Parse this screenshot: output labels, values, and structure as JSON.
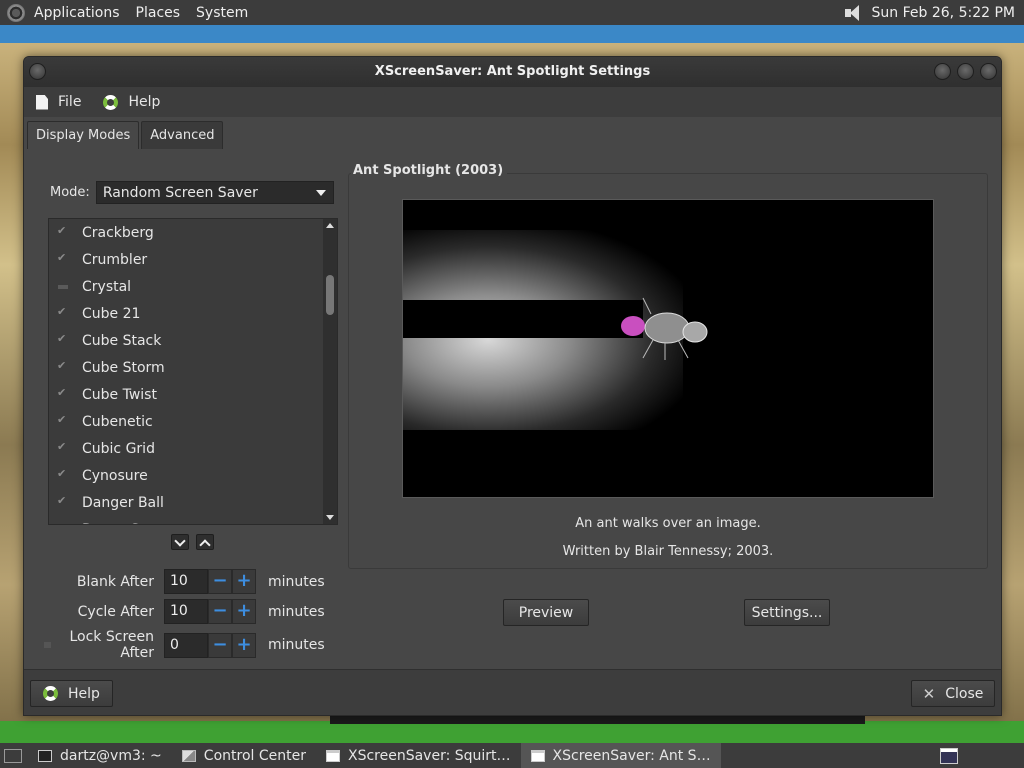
{
  "top_panel": {
    "menus": [
      "Applications",
      "Places",
      "System"
    ],
    "clock": "Sun Feb 26,  5:22 PM"
  },
  "window": {
    "title": "XScreenSaver: Ant Spotlight Settings",
    "menubar": {
      "file": "File",
      "help": "Help"
    },
    "tabs": [
      "Display Modes",
      "Advanced"
    ],
    "mode": {
      "label": "Mode:",
      "value": "Random Screen Saver"
    },
    "list": [
      {
        "name": "Crackberg",
        "checked": true
      },
      {
        "name": "Crumbler",
        "checked": true
      },
      {
        "name": "Crystal",
        "checked": false
      },
      {
        "name": "Cube 21",
        "checked": true
      },
      {
        "name": "Cube Stack",
        "checked": true
      },
      {
        "name": "Cube Storm",
        "checked": true
      },
      {
        "name": "Cube Twist",
        "checked": true
      },
      {
        "name": "Cubenetic",
        "checked": true
      },
      {
        "name": "Cubic Grid",
        "checked": true
      },
      {
        "name": "Cynosure",
        "checked": true
      },
      {
        "name": "Danger Ball",
        "checked": true
      },
      {
        "name": "Decay Screen",
        "checked": true
      }
    ],
    "spinners": [
      {
        "label": "Blank After",
        "value": "10",
        "unit": "minutes"
      },
      {
        "label": "Cycle After",
        "value": "10",
        "unit": "minutes"
      },
      {
        "label": "Lock Screen After",
        "value": "0",
        "unit": "minutes"
      }
    ],
    "preview_frame": {
      "title": "Ant Spotlight (2003)",
      "description": "An ant walks over an image.",
      "author": "Written by Blair Tennessy; 2003."
    },
    "buttons": {
      "preview": "Preview",
      "settings": "Settings...",
      "help": "Help",
      "close": "Close"
    }
  },
  "taskbar": {
    "tasks": [
      {
        "label": "dartz@vm3: ~",
        "icon": "terminal-icon"
      },
      {
        "label": "Control Center",
        "icon": "control-center-icon"
      },
      {
        "label": "XScreenSaver: Squirt…",
        "icon": "window-icon"
      },
      {
        "label": "XScreenSaver: Ant S…",
        "icon": "window-icon",
        "active": true
      }
    ]
  }
}
